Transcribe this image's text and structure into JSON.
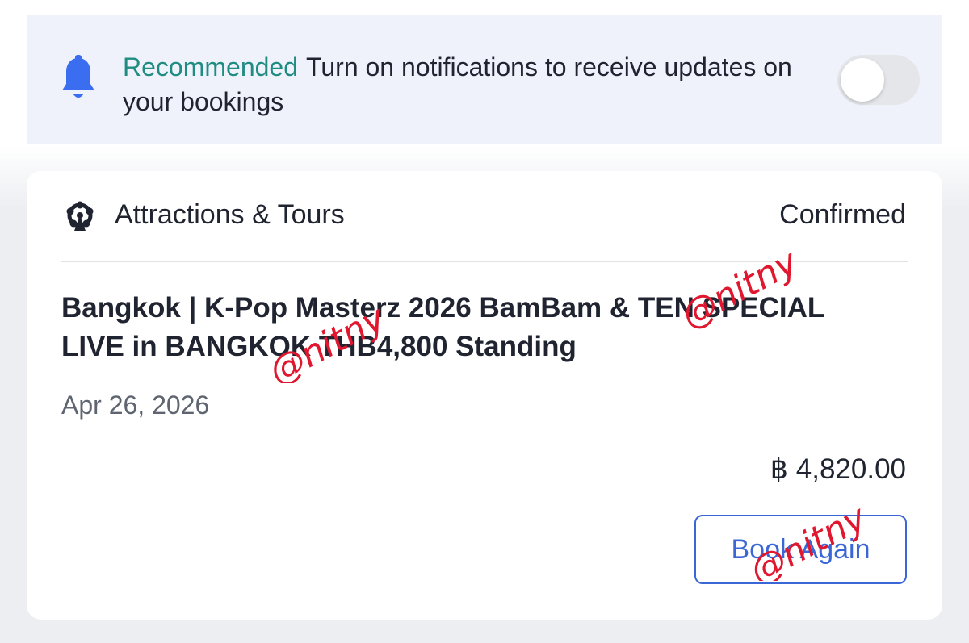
{
  "notification": {
    "recommended_label": "Recommended",
    "message": "Turn on notifications to receive updates on your bookings",
    "toggle_on": false
  },
  "booking": {
    "category": "Attractions & Tours",
    "status": "Confirmed",
    "title": "Bangkok | K-Pop Masterz 2026 BamBam & TEN SPECIAL LIVE in BANGKOK THB4,800 Standing",
    "date": "Apr 26, 2026",
    "price": "฿ 4,820.00",
    "book_again_label": "Book Again"
  },
  "watermark": "@nitny",
  "colors": {
    "accent_teal": "#1f8c82",
    "button_blue": "#3b67d6",
    "bell_blue": "#3a6df0",
    "watermark_red": "#e0172f"
  },
  "icons": {
    "notification": "bell-icon",
    "category": "ferris-wheel-icon"
  }
}
